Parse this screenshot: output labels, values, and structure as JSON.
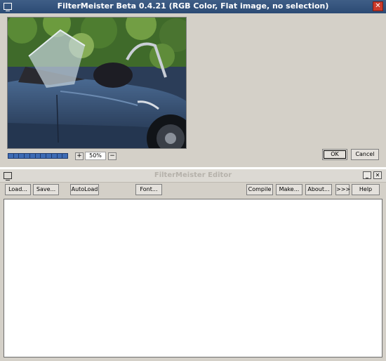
{
  "main_window": {
    "title": "FilterMeister Beta 0.4.21 (RGB Color, Flat image, no selection)",
    "close_glyph": "✕",
    "zoom": {
      "plus": "+",
      "value": "50%",
      "minus": "−"
    },
    "progress": 1.0,
    "ok_label": "OK",
    "cancel_label": "Cancel"
  },
  "editor_window": {
    "title": "FilterMeister Editor",
    "minimize_glyph": "_",
    "close_glyph": "✕",
    "toolbar": {
      "load_label": "Load...",
      "save_label": "Save...",
      "autoload_label": "AutoLoad",
      "font_label": "Font...",
      "compile_label": "Compile",
      "make_label": "Make...",
      "about_label": "About...",
      "more_label": ">>>",
      "help_label": "Help"
    },
    "editor_text": ""
  },
  "colors": {
    "titlebar_active": "#2b4a74",
    "window_bg": "#d4d0c8",
    "progress_fill": "#3d6bb4"
  }
}
